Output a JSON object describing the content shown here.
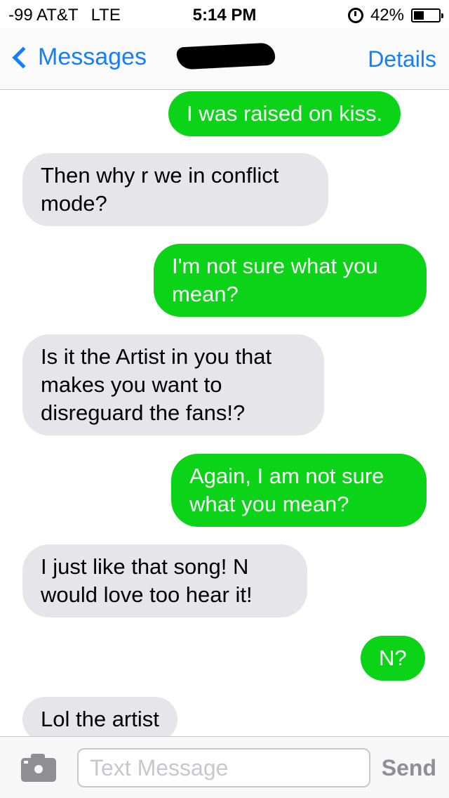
{
  "status_bar": {
    "signal": "-99 AT&T",
    "network": "LTE",
    "time": "5:14 PM",
    "alarm_icon": "alarm-icon",
    "battery_percent": "42%",
    "battery_level": 0.42
  },
  "nav": {
    "back_label": "Messages",
    "back_icon": "chevron-left-icon",
    "contact_name_redacted": true,
    "details_label": "Details",
    "accent_color": "#157efb"
  },
  "messages": [
    {
      "direction": "outgoing",
      "text": "I was raised on kiss."
    },
    {
      "direction": "incoming",
      "text": "Then why r we in conflict mode?"
    },
    {
      "direction": "outgoing",
      "text": "I'm not sure what you mean?"
    },
    {
      "direction": "incoming",
      "text": "Is it the Artist in you that makes you want to disreguard the fans!?"
    },
    {
      "direction": "outgoing",
      "text": "Again, I am not sure what you mean?"
    },
    {
      "direction": "incoming",
      "text": "I just like that song!  N would love too hear it!"
    },
    {
      "direction": "outgoing",
      "text": "N?"
    },
    {
      "direction": "incoming",
      "text": "Lol the artist"
    }
  ],
  "colors": {
    "outgoing_bubble": "#0bd318",
    "incoming_bubble": "#e5e5ea"
  },
  "input_bar": {
    "camera_icon": "camera-icon",
    "placeholder": "Text Message",
    "value": "",
    "send_label": "Send"
  }
}
